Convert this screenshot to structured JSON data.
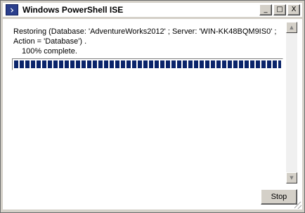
{
  "window": {
    "title": "Windows PowerShell ISE",
    "icon": "powershell-icon",
    "controls": {
      "minimize": "_",
      "maximize": "□",
      "close": "X"
    }
  },
  "message": {
    "line1": "Restoring (Database: 'AdventureWorks2012' ; Server: 'WIN-KK48BQM9IS0' ;",
    "line2": "Action = 'Database') .",
    "line3": "100% complete."
  },
  "progress": {
    "percent": 100
  },
  "scrollbar": {
    "up_arrow": "▲",
    "down_arrow": "▼"
  },
  "buttons": {
    "stop_label": "Stop"
  },
  "colors": {
    "progress_fill": "#0a246a",
    "window_face": "#d4d0c8"
  }
}
